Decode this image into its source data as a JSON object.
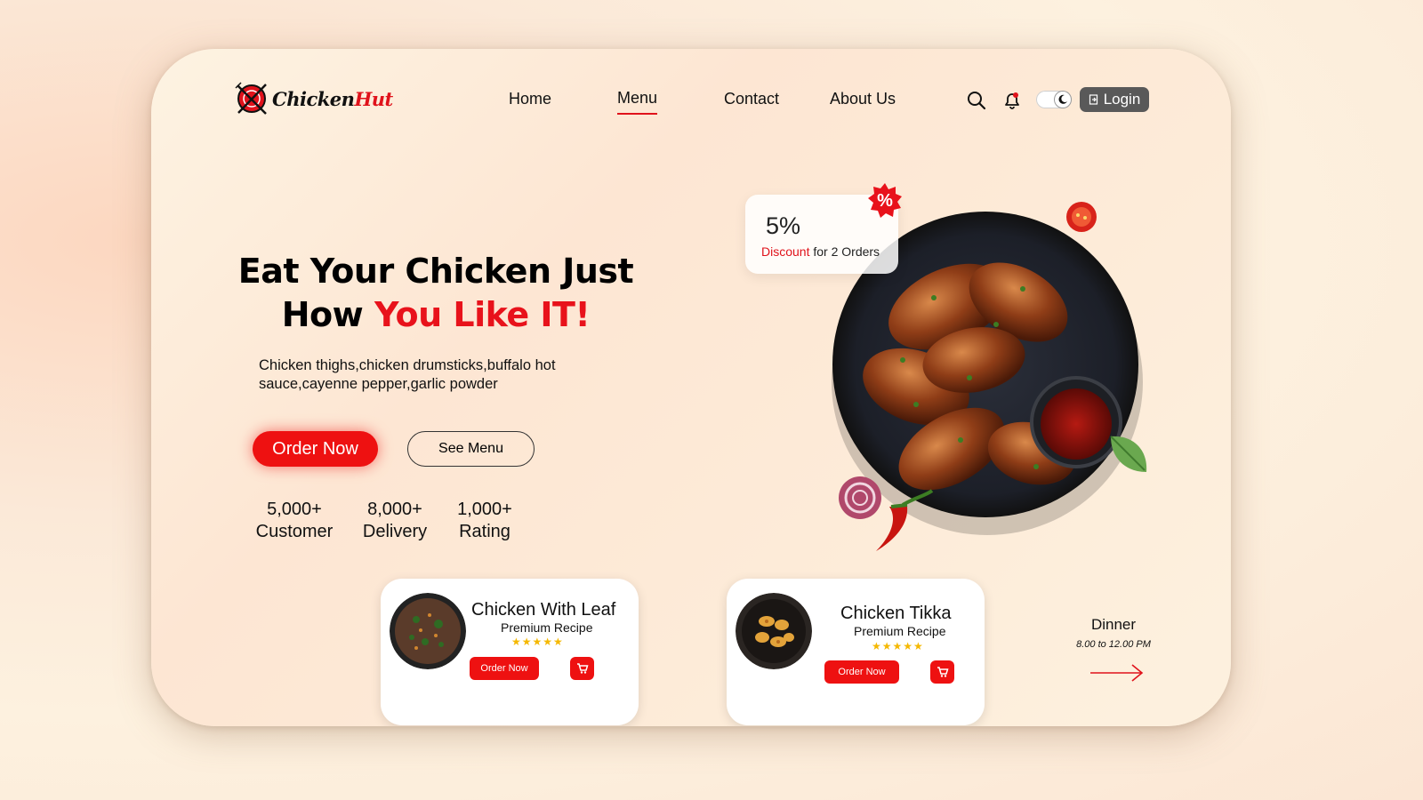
{
  "brand": {
    "name_part1": "Chicken",
    "name_part2": "Hut"
  },
  "nav": {
    "items": [
      "Home",
      "Menu",
      "Contact",
      "About Us"
    ],
    "active": "Menu"
  },
  "header": {
    "login_label": "Login"
  },
  "hero": {
    "title_line1": "Eat Your Chicken Just",
    "title_line2_a": "How ",
    "title_line2_b": "You Like IT!",
    "description": "Chicken thighs,chicken drumsticks,buffalo hot sauce,cayenne pepper,garlic powder",
    "order_label": "Order Now",
    "menu_label": "See Menu"
  },
  "stats": [
    {
      "value": "5,000+",
      "label": "Customer"
    },
    {
      "value": "8,000+",
      "label": "Delivery"
    },
    {
      "value": "1,000+",
      "label": "Rating"
    }
  ],
  "discount": {
    "percent": "5%",
    "word": "Discount",
    "text": " for 2 Orders",
    "badge": "%"
  },
  "recipes": [
    {
      "title": "Chicken With Leaf",
      "subtitle": "Premium Recipe",
      "stars": "★★★★★",
      "rating": 5,
      "order_label": "Order Now"
    },
    {
      "title": "Chicken Tikka",
      "subtitle": "Premium Recipe",
      "stars": "★★★★★",
      "rating": 5,
      "order_label": "Order Now"
    }
  ],
  "dinner": {
    "title": "Dinner",
    "hours": "8.00 to 12.00 PM"
  },
  "colors": {
    "accent": "#ee1111",
    "login_bg": "#595959",
    "star": "#f5b800"
  }
}
